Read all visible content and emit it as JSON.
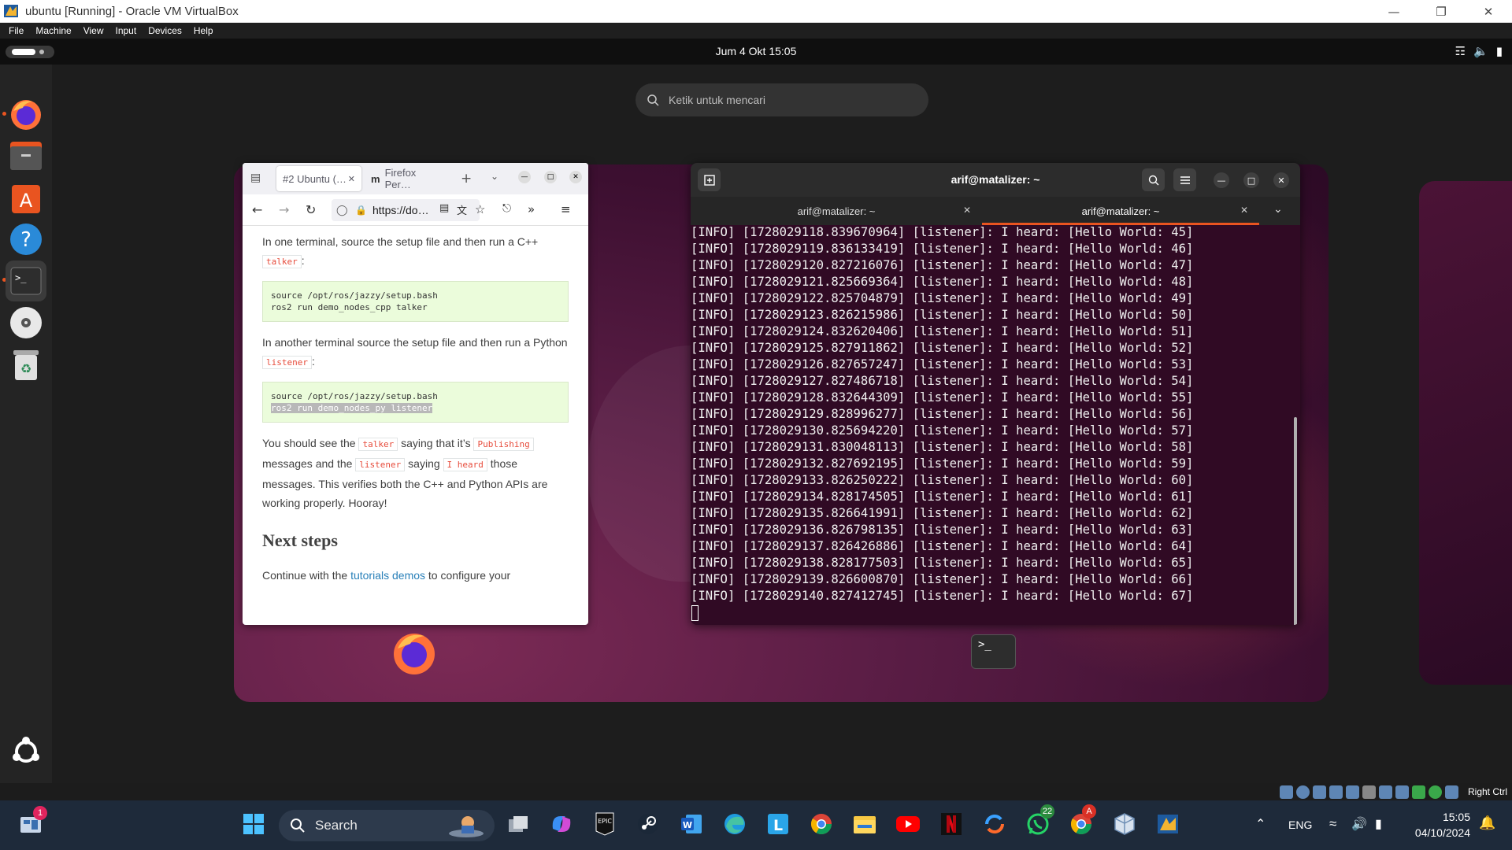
{
  "vbox": {
    "title": "ubuntu [Running] - Oracle VM VirtualBox",
    "menu": [
      "File",
      "Machine",
      "View",
      "Input",
      "Devices",
      "Help"
    ],
    "status_hostkey": "Right Ctrl"
  },
  "ubuntu": {
    "clock": "Jum   4 Okt  15:05",
    "search_placeholder": "Ketik untuk mencari",
    "dock": [
      "firefox-icon",
      "files-icon",
      "app-center-icon",
      "help-icon",
      "terminal-icon",
      "disc-icon",
      "trash-icon",
      "show-apps-icon"
    ]
  },
  "firefox": {
    "tabs": [
      {
        "label": "#2 Ubuntu (…"
      },
      {
        "label": "Firefox Per…"
      }
    ],
    "url": "https://do…",
    "content": {
      "p1_pre": "In one terminal, source the setup file and then run a C++",
      "p1_code": "talker",
      "p1_post": ":",
      "code1_line1": "source /opt/ros/jazzy/setup.bash",
      "code1_line2": "ros2 run demo_nodes_cpp talker",
      "p2_pre": "In another terminal source the setup file and then run a Python",
      "p2_code": "listener",
      "p2_post": ":",
      "code2_line1": "source /opt/ros/jazzy/setup.bash",
      "code2_line2": "ros2 run demo_nodes_py listener",
      "p3_a": "You should see the",
      "p3_code1": "talker",
      "p3_b": "saying that it’s",
      "p3_code2": "Publishing",
      "p3_c": "messages and the",
      "p3_code3": "listener",
      "p3_d": "saying",
      "p3_code4": "I heard",
      "p3_e": "those messages. This verifies both the C++ and Python APIs are working properly. Hooray!",
      "heading": "Next steps",
      "p4_pre": "Continue with the",
      "p4_link1": "tutorials",
      "p4_link2": "demos",
      "p4_post": "to configure your"
    }
  },
  "terminal": {
    "title": "arif@matalizer: ~",
    "tabs": [
      {
        "label": "arif@matalizer: ~"
      },
      {
        "label": "arif@matalizer: ~"
      }
    ],
    "lines": [
      "[INFO] [1728029118.839670964] [listener]: I heard: [Hello World: 45]",
      "[INFO] [1728029119.836133419] [listener]: I heard: [Hello World: 46]",
      "[INFO] [1728029120.827216076] [listener]: I heard: [Hello World: 47]",
      "[INFO] [1728029121.825669364] [listener]: I heard: [Hello World: 48]",
      "[INFO] [1728029122.825704879] [listener]: I heard: [Hello World: 49]",
      "[INFO] [1728029123.826215986] [listener]: I heard: [Hello World: 50]",
      "[INFO] [1728029124.832620406] [listener]: I heard: [Hello World: 51]",
      "[INFO] [1728029125.827911862] [listener]: I heard: [Hello World: 52]",
      "[INFO] [1728029126.827657247] [listener]: I heard: [Hello World: 53]",
      "[INFO] [1728029127.827486718] [listener]: I heard: [Hello World: 54]",
      "[INFO] [1728029128.832644309] [listener]: I heard: [Hello World: 55]",
      "[INFO] [1728029129.828996277] [listener]: I heard: [Hello World: 56]",
      "[INFO] [1728029130.825694220] [listener]: I heard: [Hello World: 57]",
      "[INFO] [1728029131.830048113] [listener]: I heard: [Hello World: 58]",
      "[INFO] [1728029132.827692195] [listener]: I heard: [Hello World: 59]",
      "[INFO] [1728029133.826250222] [listener]: I heard: [Hello World: 60]",
      "[INFO] [1728029134.828174505] [listener]: I heard: [Hello World: 61]",
      "[INFO] [1728029135.826641991] [listener]: I heard: [Hello World: 62]",
      "[INFO] [1728029136.826798135] [listener]: I heard: [Hello World: 63]",
      "[INFO] [1728029137.826426886] [listener]: I heard: [Hello World: 64]",
      "[INFO] [1728029138.828177503] [listener]: I heard: [Hello World: 65]",
      "[INFO] [1728029139.826600870] [listener]: I heard: [Hello World: 66]",
      "[INFO] [1728029140.827412745] [listener]: I heard: [Hello World: 67]"
    ],
    "float_icon": ">_"
  },
  "taskbar": {
    "search_label": "Search",
    "notification_badge": "1",
    "whatsapp_badge": "22",
    "chrome_badge": "A",
    "lang": "ENG",
    "time": "15:05",
    "date": "04/10/2024",
    "apps": [
      "start-icon",
      "task-view-icon",
      "copilot-icon",
      "epic-games-icon",
      "steam-icon",
      "word-icon",
      "edge-icon",
      "l-app-icon",
      "chrome-icon",
      "file-explorer-icon",
      "youtube-icon",
      "netflix-icon",
      "sync-icon",
      "whatsapp-icon",
      "chrome-profile-icon",
      "virtualbox-icon",
      "virtualbox-vm-icon"
    ]
  }
}
